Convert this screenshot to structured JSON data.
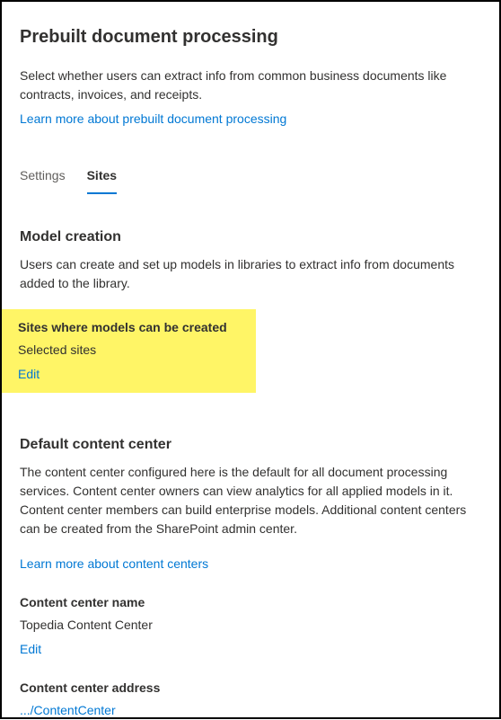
{
  "header": {
    "title": "Prebuilt document processing",
    "description": "Select whether users can extract info from common business documents like contracts, invoices, and receipts.",
    "learn_more": "Learn more about prebuilt document processing"
  },
  "tabs": {
    "settings": "Settings",
    "sites": "Sites"
  },
  "model_creation": {
    "heading": "Model creation",
    "description": "Users can create and set up models in libraries to extract info from documents added to the library.",
    "sites_label": "Sites where models can be created",
    "sites_value": "Selected sites",
    "edit_label": "Edit"
  },
  "default_center": {
    "heading": "Default content center",
    "description": "The content center configured here is the default for all document processing services. Content center owners can view analytics for all applied models in it. Content center members can build enterprise models. Additional content centers can be created from the SharePoint admin center.",
    "learn_more": "Learn more about content centers",
    "name_label": "Content center name",
    "name_value": "Topedia Content Center",
    "edit_label": "Edit",
    "address_label": "Content center address",
    "address_value": ".../ContentCenter"
  }
}
